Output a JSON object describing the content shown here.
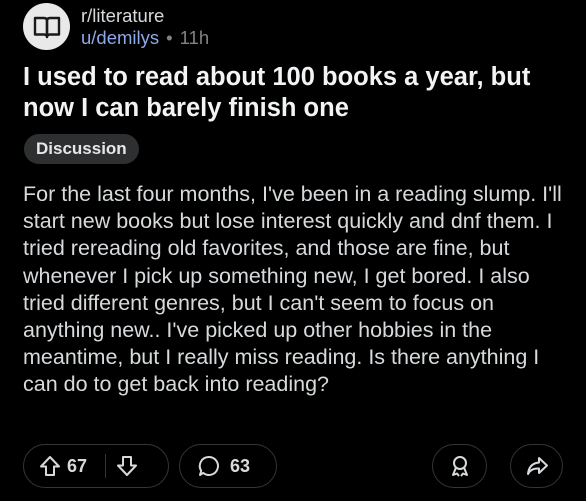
{
  "post": {
    "subreddit": "r/literature",
    "username": "u/demilys",
    "separator": "•",
    "age": "11h",
    "title": "I used to read about 100 books a year, but now I can barely finish one",
    "flair": "Discussion",
    "body": "For the last four months, I've been in a reading slump. I'll start new books but lose interest quickly and dnf them. I tried rereading old favorites, and those are fine, but whenever I pick up something new, I get bored. I also tried different genres, but I can't seem to focus on anything new.. I've picked up other hobbies in the meantime, but I really miss reading. Is there anything I can do to get back into reading?"
  },
  "actions": {
    "upvotes": "67",
    "comments": "63"
  },
  "icons": {
    "avatar": "book-icon",
    "upvote": "arrow-up-icon",
    "downvote": "arrow-down-icon",
    "comment": "comment-bubble-icon",
    "award": "award-icon",
    "share": "share-icon"
  },
  "colors": {
    "background": "#000000",
    "username": "#8ea9e8",
    "flair_bg": "#2d2f31"
  }
}
